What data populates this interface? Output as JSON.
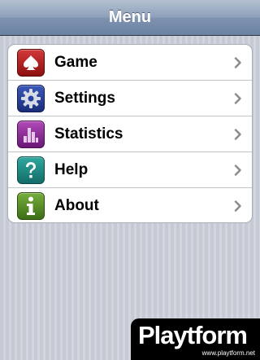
{
  "navbar": {
    "title": "Menu"
  },
  "menu": {
    "items": [
      {
        "label": "Game",
        "icon": "spade-icon",
        "color": "#b01c1c"
      },
      {
        "label": "Settings",
        "icon": "gear-icon",
        "color": "#2a40a0"
      },
      {
        "label": "Statistics",
        "icon": "bar-chart-icon",
        "color": "#8e2b9a"
      },
      {
        "label": "Help",
        "icon": "question-mark-icon",
        "color": "#1e8c85"
      },
      {
        "label": "About",
        "icon": "info-icon",
        "color": "#568f28"
      }
    ]
  },
  "watermark": {
    "logo": "Playtform",
    "url": "www.playtform.net"
  }
}
